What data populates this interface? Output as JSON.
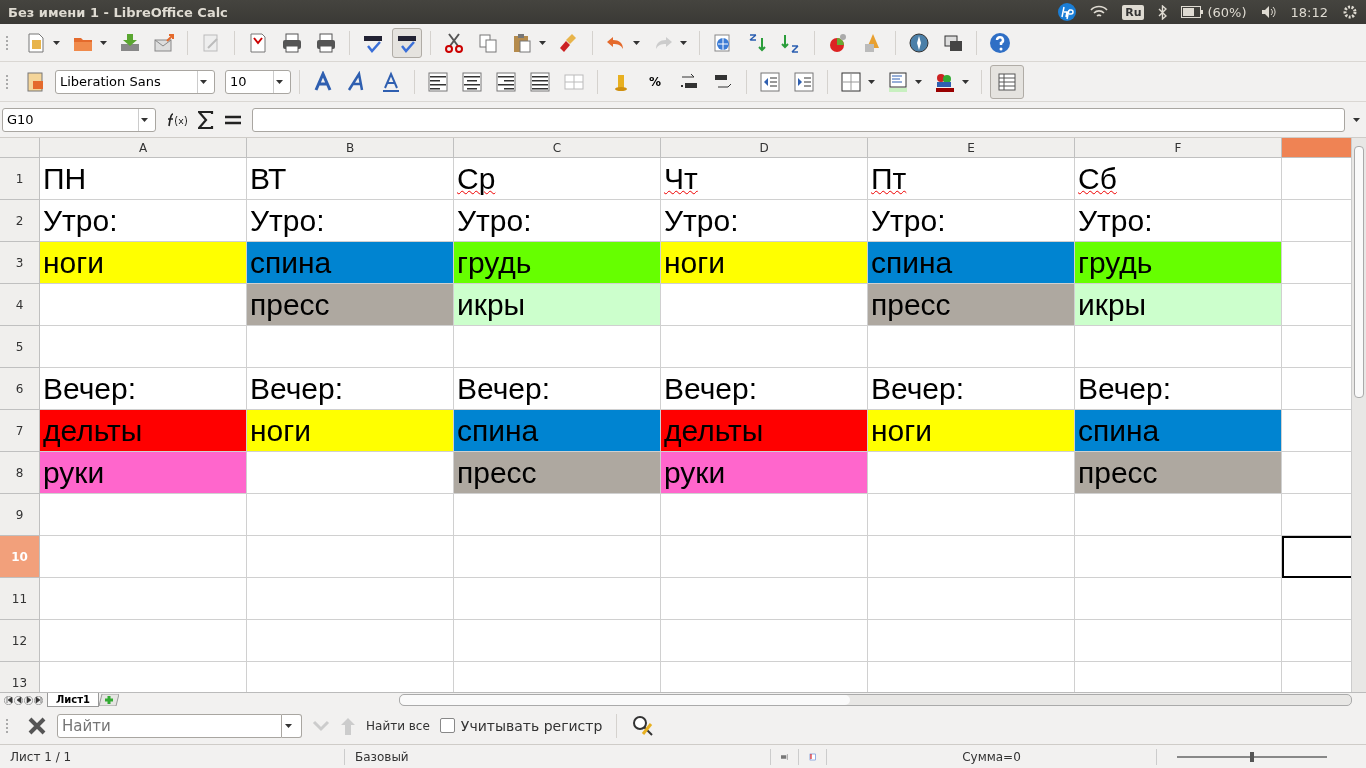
{
  "window": {
    "title": "Без имени 1 - LibreOffice Calc"
  },
  "tray": {
    "keyboard": "Ru",
    "battery": "(60%)",
    "clock": "18:12"
  },
  "standard_toolbar": {
    "auto_spellcheck": true
  },
  "formatting_toolbar": {
    "font_name": "Liberation Sans",
    "font_size": "10",
    "percent": "%",
    "grid_lines": true
  },
  "formula_bar": {
    "name_box": "G10"
  },
  "columns": [
    {
      "label": "A",
      "selected": false
    },
    {
      "label": "B",
      "selected": false
    },
    {
      "label": "C",
      "selected": false
    },
    {
      "label": "D",
      "selected": false
    },
    {
      "label": "E",
      "selected": false
    },
    {
      "label": "F",
      "selected": false
    },
    {
      "selected": true
    }
  ],
  "rows": [
    {
      "label": "1",
      "selected": false,
      "cells": [
        {
          "text": "ПН",
          "misspelled": false
        },
        {
          "text": "ВТ",
          "misspelled": false
        },
        {
          "text": "Ср",
          "misspelled": true
        },
        {
          "text": "Чт",
          "misspelled": true
        },
        {
          "text": "Пт",
          "misspelled": true
        },
        {
          "text": "Сб",
          "misspelled": true
        }
      ]
    },
    {
      "label": "2",
      "selected": false,
      "cells": [
        {
          "text": "Утро:"
        },
        {
          "text": "Утро:"
        },
        {
          "text": "Утро:"
        },
        {
          "text": "Утро:"
        },
        {
          "text": "Утро:"
        },
        {
          "text": "Утро:"
        }
      ]
    },
    {
      "label": "3",
      "selected": false,
      "cells": [
        {
          "text": "ноги",
          "color": "#ffff00"
        },
        {
          "text": "спина",
          "color": "#0084d1"
        },
        {
          "text": "грудь",
          "color": "#66ff00"
        },
        {
          "text": "ноги",
          "color": "#ffff00"
        },
        {
          "text": "спина",
          "color": "#0084d1"
        },
        {
          "text": "грудь",
          "color": "#66ff00"
        }
      ]
    },
    {
      "label": "4",
      "selected": false,
      "cells": [
        {},
        {
          "text": "пресс",
          "color": "#aea8a0"
        },
        {
          "text": "икры",
          "color": "#ccffcc"
        },
        {},
        {
          "text": "пресс",
          "color": "#aea8a0"
        },
        {
          "text": "икры",
          "color": "#ccffcc"
        }
      ]
    },
    {
      "label": "5",
      "selected": false,
      "cells": []
    },
    {
      "label": "6",
      "selected": false,
      "cells": [
        {
          "text": "Вечер:"
        },
        {
          "text": "Вечер:"
        },
        {
          "text": "Вечер:"
        },
        {
          "text": "Вечер:"
        },
        {
          "text": "Вечер:"
        },
        {
          "text": "Вечер:"
        }
      ]
    },
    {
      "label": "7",
      "selected": false,
      "cells": [
        {
          "text": "дельты",
          "color": "#ff0000"
        },
        {
          "text": "ноги",
          "color": "#ffff00"
        },
        {
          "text": "спина",
          "color": "#0084d1"
        },
        {
          "text": "дельты",
          "color": "#ff0000"
        },
        {
          "text": "ноги",
          "color": "#ffff00"
        },
        {
          "text": "спина",
          "color": "#0084d1"
        }
      ]
    },
    {
      "label": "8",
      "selected": false,
      "cells": [
        {
          "text": "руки",
          "color": "#ff66cc"
        },
        {},
        {
          "text": "пресс",
          "color": "#aea8a0"
        },
        {
          "text": "руки",
          "color": "#ff66cc"
        },
        {},
        {
          "text": "пресс",
          "color": "#aea8a0"
        }
      ]
    },
    {
      "label": "9",
      "selected": false,
      "cells": []
    },
    {
      "label": "10",
      "selected": true,
      "cells": []
    },
    {
      "label": "11",
      "selected": false,
      "cells": []
    },
    {
      "label": "12",
      "selected": false,
      "cells": []
    },
    {
      "label": "13",
      "selected": false,
      "cells": []
    }
  ],
  "sheet_tabs": [
    {
      "label": "Лист1",
      "selected": true
    }
  ],
  "find_bar": {
    "placeholder": "Найти",
    "find_all": "Найти все",
    "match_case": {
      "label": "Учитывать регистр",
      "checked": false
    }
  },
  "status_bar": {
    "sheet": "Лист 1 / 1",
    "page_style": "Базовый",
    "sum": "Сумма=0",
    "zoom": {
      "level": 0.5
    }
  }
}
